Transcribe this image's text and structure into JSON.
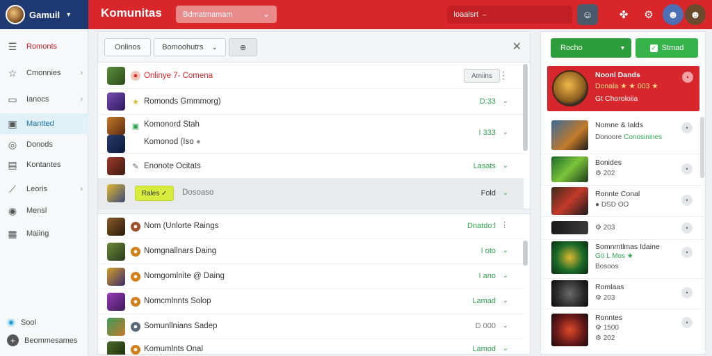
{
  "header": {
    "brand_name": "Gamuil",
    "app_title": "Komunitas",
    "search_text": "Bdmatmamam",
    "filter_text": "Ioaalsrt"
  },
  "sidebar": {
    "items": [
      {
        "label": "Romonts",
        "icon": "list-icon"
      },
      {
        "label": "Cmonnies",
        "icon": "star-icon"
      },
      {
        "label": "Ianocs",
        "icon": "card-icon"
      },
      {
        "label": "Mantted",
        "icon": "square-icon"
      },
      {
        "label": "Donods",
        "icon": "target-icon"
      },
      {
        "label": "Kontantes",
        "icon": "grid-icon"
      },
      {
        "label": "Leoris",
        "icon": "chart-icon"
      },
      {
        "label": "Mensl",
        "icon": "globe-icon"
      },
      {
        "label": "Maiing",
        "icon": "box-icon"
      }
    ],
    "footer": [
      {
        "label": "Sool"
      },
      {
        "label": "Beommesames"
      }
    ]
  },
  "toolbar": {
    "btn_online": "Onlinos",
    "btn_filter": "Bomoohutrs",
    "btn_icon": "⊕"
  },
  "rows_top": [
    {
      "label": "Onlinye  7- Comena",
      "status": "Amiins",
      "red": true
    },
    {
      "label": "Romonds Gmmmorg)",
      "status": "D:33"
    },
    {
      "label": "Komonord Stah",
      "status": "I 333"
    },
    {
      "label": "Komonod  (Iso",
      "status": ""
    },
    {
      "label": "Enonote  Ocitats",
      "status": "Lasats"
    },
    {
      "label": "Dosoaso",
      "status": "Fold",
      "tag": "Rales ✓"
    }
  ],
  "rows_bottom": [
    {
      "label": "Nom (Unlorte Raings",
      "status": "Dnatdo:l"
    },
    {
      "label": "Nomgnallnars  Daing",
      "status": "I oto"
    },
    {
      "label": "Nomgomlnite @ Daing",
      "status": "I ano"
    },
    {
      "label": "Nomcmlnnts  Solop",
      "status": "Lamad"
    },
    {
      "label": "Somunllnians  Sadep",
      "status": "D 000"
    },
    {
      "label": "Komumlnts  Onal",
      "status": "Lamod"
    }
  ],
  "right_panel": {
    "btn_primary": "Rocho",
    "btn_secondary": "Stmad",
    "featured": {
      "title": "Noonl Dands",
      "sub1": "Donala ★ ★ 003 ★",
      "sub2": "Gt Choroloiia"
    },
    "items": [
      {
        "title": "Nomne & Ialds",
        "sub": "Donoore",
        "sub_green": "Conosinines"
      },
      {
        "title": "Bonides",
        "sub": "⚙ 202"
      },
      {
        "title": "Ronnte Conal",
        "sub": "● DSD OO"
      },
      {
        "title": "",
        "sub": "⚙ 203"
      },
      {
        "title": "Somnmtlmas Idaine",
        "sub": "Gö L  Mos ★",
        "sub2": "Bosoos"
      },
      {
        "title": "Romlaas",
        "sub": "⚙ 203"
      },
      {
        "title": "Ronntes",
        "sub": "⚙ 1500",
        "sub2": "⚙ 202"
      }
    ]
  }
}
